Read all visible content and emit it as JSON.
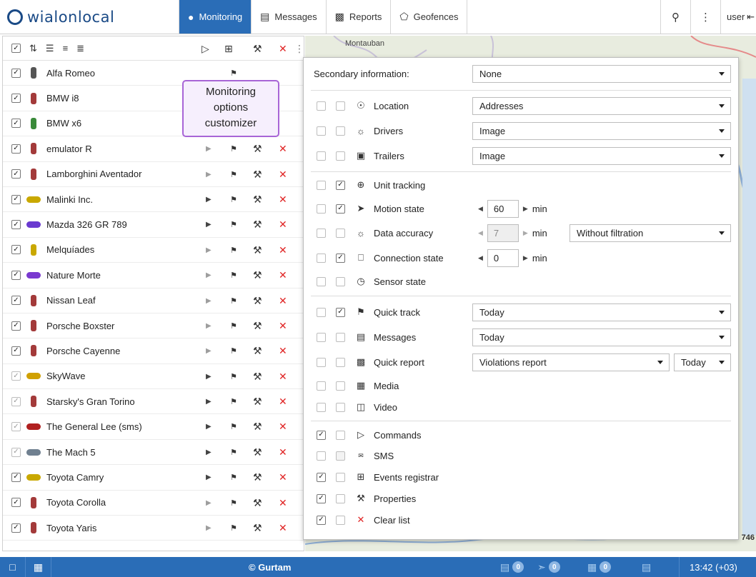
{
  "app": {
    "logo_text": "wialonlocal"
  },
  "nav": {
    "tabs": [
      {
        "label": "Monitoring",
        "icon": "globe-icon"
      },
      {
        "label": "Messages",
        "icon": "messages-icon"
      },
      {
        "label": "Reports",
        "icon": "reports-icon"
      },
      {
        "label": "Geofences",
        "icon": "geofence-icon"
      }
    ],
    "user_label": "user"
  },
  "units": [
    {
      "name": "Alfa Romeo",
      "icon_color": "#555555",
      "checked": true
    },
    {
      "name": "BMW i8",
      "icon_color": "#a33a3a",
      "checked": true
    },
    {
      "name": "BMW x6",
      "icon_color": "#3a8a3a",
      "checked": true
    },
    {
      "name": "emulator R",
      "icon_color": "#a33a3a",
      "checked": true
    },
    {
      "name": "Lamborghini Aventador",
      "icon_color": "#a33a3a",
      "checked": true
    },
    {
      "name": "Malinki Inc.",
      "icon_color": "#c9a800",
      "checked": true
    },
    {
      "name": "Mazda 326 GR 789",
      "icon_color": "#6a3ad0",
      "checked": true
    },
    {
      "name": "Melquíades",
      "icon_color": "#c9a800",
      "checked": true
    },
    {
      "name": "Nature Morte",
      "icon_color": "#7a3ad0",
      "checked": true
    },
    {
      "name": "Nissan Leaf",
      "icon_color": "#a33a3a",
      "checked": true
    },
    {
      "name": "Porsche Boxster",
      "icon_color": "#a33a3a",
      "checked": true
    },
    {
      "name": "Porsche Cayenne",
      "icon_color": "#a33a3a",
      "checked": true
    },
    {
      "name": "SkyWave",
      "icon_color": "#d0a000",
      "checked": false
    },
    {
      "name": "Starsky's Gran Torino",
      "icon_color": "#a33a3a",
      "checked": false
    },
    {
      "name": "The General Lee (sms)",
      "icon_color": "#b02020",
      "checked": false
    },
    {
      "name": "The Mach 5",
      "icon_color": "#708090",
      "checked": false
    },
    {
      "name": "Toyota Camry",
      "icon_color": "#c9a800",
      "checked": true
    },
    {
      "name": "Toyota Corolla",
      "icon_color": "#a33a3a",
      "checked": true
    },
    {
      "name": "Toyota Yaris",
      "icon_color": "#a33a3a",
      "checked": true
    }
  ],
  "tooltip": {
    "line1": "Monitoring",
    "line2": "options",
    "line3": "customizer"
  },
  "map": {
    "label": "Montauban",
    "corner_number": "746"
  },
  "options": {
    "secondary_label": "Secondary information:",
    "secondary_value": "None",
    "items": [
      {
        "label": "Location",
        "icon": "location-icon",
        "select": "Addresses"
      },
      {
        "label": "Drivers",
        "icon": "driver-icon",
        "select": "Image"
      },
      {
        "label": "Trailers",
        "icon": "trailer-icon",
        "select": "Image"
      },
      {
        "label": "Unit tracking",
        "icon": "crosshair-icon"
      },
      {
        "label": "Motion state",
        "icon": "motion-icon",
        "stepper": "60",
        "unit": "min"
      },
      {
        "label": "Data accuracy",
        "icon": "accuracy-icon",
        "stepper": "7",
        "unit": "min",
        "select": "Without filtration"
      },
      {
        "label": "Connection state",
        "icon": "connection-icon",
        "stepper": "0",
        "unit": "min"
      },
      {
        "label": "Sensor state",
        "icon": "sensor-icon"
      },
      {
        "label": "Quick track",
        "icon": "quick-track-icon",
        "select": "Today"
      },
      {
        "label": "Messages",
        "icon": "messages-icon",
        "select": "Today"
      },
      {
        "label": "Quick report",
        "icon": "reports-icon",
        "select": "Violations report",
        "select2": "Today"
      },
      {
        "label": "Media",
        "icon": "media-icon"
      },
      {
        "label": "Video",
        "icon": "video-icon"
      },
      {
        "label": "Commands",
        "icon": "commands-icon"
      },
      {
        "label": "SMS",
        "icon": "sms-icon"
      },
      {
        "label": "Events registrar",
        "icon": "events-icon"
      },
      {
        "label": "Properties",
        "icon": "wrench-icon"
      },
      {
        "label": "Clear list",
        "icon": "close-icon"
      }
    ]
  },
  "footer": {
    "copyright": "© Gurtam",
    "messages_count": "0",
    "notifications_count": "0",
    "media_count": "0",
    "time": "13:42 (+03)"
  }
}
